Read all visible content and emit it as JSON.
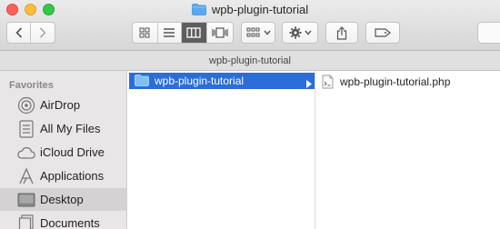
{
  "window": {
    "title": "wpb-plugin-tutorial"
  },
  "toolbar": {
    "back": "back",
    "forward": "forward",
    "views": [
      "icon-view",
      "list-view",
      "column-view",
      "cover-flow-view"
    ],
    "active_view": "column-view"
  },
  "pathbar": {
    "text": "wpb-plugin-tutorial"
  },
  "sidebar": {
    "heading": "Favorites",
    "items": [
      {
        "label": "AirDrop",
        "icon": "airdrop-icon"
      },
      {
        "label": "All My Files",
        "icon": "all-files-icon"
      },
      {
        "label": "iCloud Drive",
        "icon": "cloud-icon"
      },
      {
        "label": "Applications",
        "icon": "applications-icon"
      },
      {
        "label": "Desktop",
        "icon": "desktop-icon",
        "selected": true
      },
      {
        "label": "Documents",
        "icon": "documents-icon"
      }
    ]
  },
  "columns": {
    "first": {
      "selected_item": "wpb-plugin-tutorial"
    },
    "second": {
      "file": "wpb-plugin-tutorial.php"
    }
  },
  "colors": {
    "selection": "#2b6dd9",
    "folder": "#5aa9f0"
  }
}
